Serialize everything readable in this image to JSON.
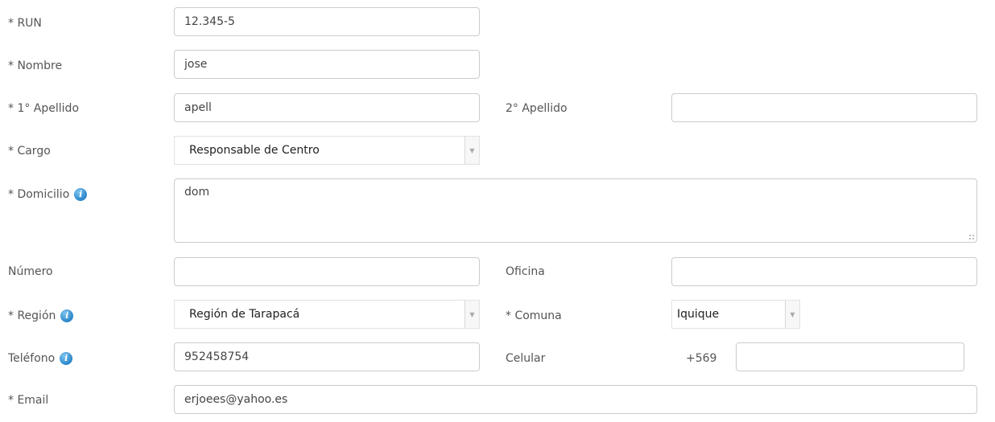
{
  "form": {
    "run": {
      "label": "* RUN",
      "value": "12.345-5"
    },
    "nombre": {
      "label": "* Nombre",
      "value": "jose"
    },
    "apellido1": {
      "label": "* 1° Apellido",
      "value": "apell"
    },
    "apellido2": {
      "label": "2° Apellido",
      "value": ""
    },
    "cargo": {
      "label": "* Cargo",
      "value": "Responsable de Centro"
    },
    "domicilio": {
      "label": "* Domicilio",
      "value": "dom"
    },
    "numero": {
      "label": "Número",
      "value": ""
    },
    "oficina": {
      "label": "Oficina",
      "value": ""
    },
    "region": {
      "label": "* Región",
      "value": "Región de Tarapacá"
    },
    "comuna": {
      "label": "* Comuna",
      "value": "Iquique"
    },
    "telefono": {
      "label": "Teléfono",
      "value": "952458754"
    },
    "celular": {
      "label": "Celular",
      "prefix": "+569",
      "value": ""
    },
    "email": {
      "label": "* Email",
      "value": "erjoees@yahoo.es"
    }
  },
  "icons": {
    "info": "info-icon",
    "chevron": "chevron-down-icon"
  }
}
